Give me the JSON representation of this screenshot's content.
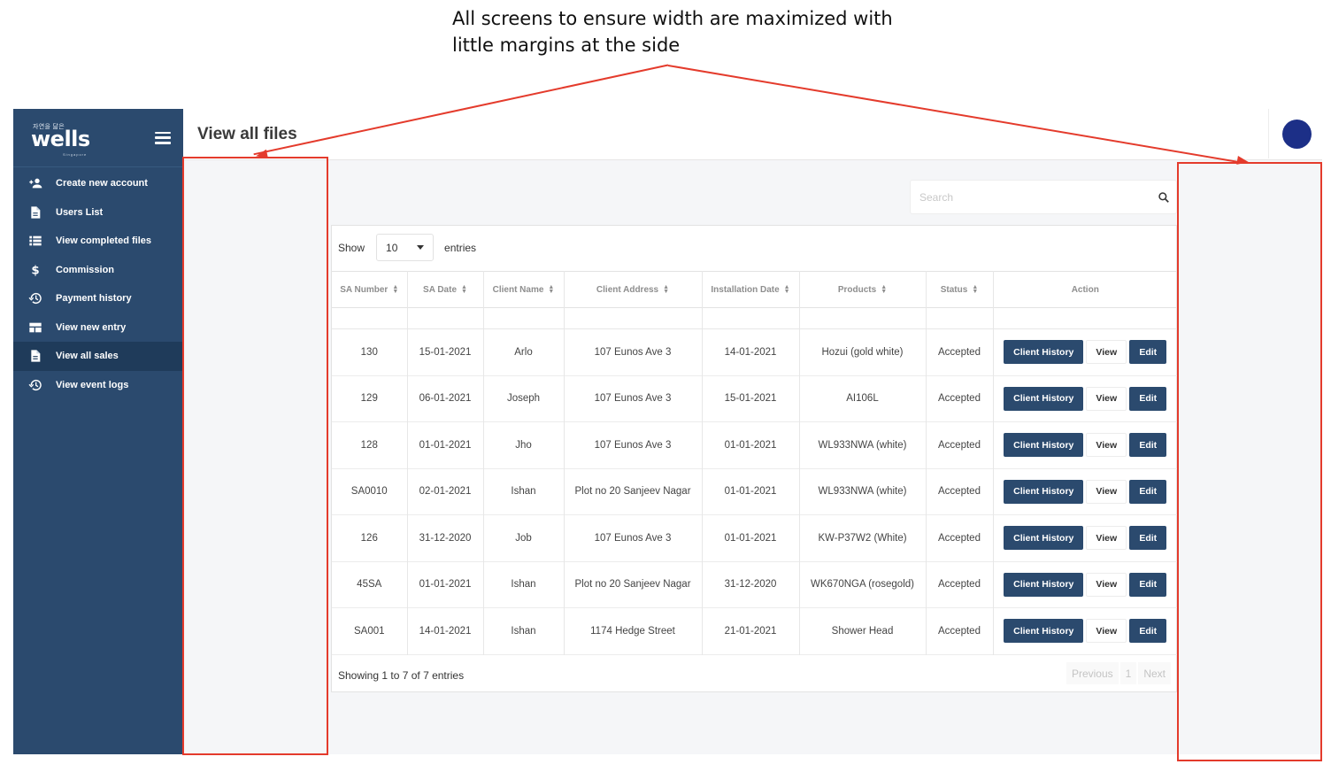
{
  "annotation": {
    "line1": "All screens to ensure width are maximized with",
    "line2": "little margins at the side"
  },
  "sidebar": {
    "logo_tag": "자연을 닮은",
    "logo_text": "wells",
    "logo_sub": "Singapore",
    "items": [
      {
        "label": "Create new account",
        "icon": "add-user-icon"
      },
      {
        "label": "Users List",
        "icon": "document-icon"
      },
      {
        "label": "View completed files",
        "icon": "list-icon"
      },
      {
        "label": "Commission",
        "icon": "dollar-icon"
      },
      {
        "label": "Payment history",
        "icon": "history-icon"
      },
      {
        "label": "View new entry",
        "icon": "table-icon"
      },
      {
        "label": "View all sales",
        "icon": "document-icon"
      },
      {
        "label": "View event logs",
        "icon": "history-icon"
      }
    ],
    "active_item": "View all sales"
  },
  "header": {
    "title": "View all files"
  },
  "search": {
    "placeholder": "Search",
    "icon": "search-icon"
  },
  "table_controls": {
    "show_label": "Show",
    "page_length": "10",
    "entries_label": "entries"
  },
  "table": {
    "columns": [
      "SA Number",
      "SA Date",
      "Client Name",
      "Client Address",
      "Installation Date",
      "Products",
      "Status",
      "Action"
    ],
    "rows": [
      {
        "sa_number": "130",
        "sa_date": "15-01-2021",
        "client_name": "Arlo",
        "client_address": "107 Eunos Ave 3",
        "installation_date": "14-01-2021",
        "products": "Hozui (gold white)",
        "status": "Accepted"
      },
      {
        "sa_number": "129",
        "sa_date": "06-01-2021",
        "client_name": "Joseph",
        "client_address": "107 Eunos Ave 3",
        "installation_date": "15-01-2021",
        "products": "AI106L",
        "status": "Accepted"
      },
      {
        "sa_number": "128",
        "sa_date": "01-01-2021",
        "client_name": "Jho",
        "client_address": "107 Eunos Ave 3",
        "installation_date": "01-01-2021",
        "products": "WL933NWA (white)",
        "status": "Accepted"
      },
      {
        "sa_number": "SA0010",
        "sa_date": "02-01-2021",
        "client_name": "Ishan",
        "client_address": "Plot no 20 Sanjeev Nagar",
        "installation_date": "01-01-2021",
        "products": "WL933NWA (white)",
        "status": "Accepted"
      },
      {
        "sa_number": "126",
        "sa_date": "31-12-2020",
        "client_name": "Job",
        "client_address": "107 Eunos Ave 3",
        "installation_date": "01-01-2021",
        "products": "KW-P37W2 (White)",
        "status": "Accepted"
      },
      {
        "sa_number": "45SA",
        "sa_date": "01-01-2021",
        "client_name": "Ishan",
        "client_address": "Plot no 20 Sanjeev Nagar",
        "installation_date": "31-12-2020",
        "products": "WK670NGA (rosegold)",
        "status": "Accepted"
      },
      {
        "sa_number": "SA001",
        "sa_date": "14-01-2021",
        "client_name": "Ishan",
        "client_address": "1174 Hedge Street",
        "installation_date": "21-01-2021",
        "products": "Shower Head",
        "status": "Accepted"
      }
    ],
    "action_labels": {
      "history": "Client History",
      "view": "View",
      "edit": "Edit"
    }
  },
  "footer": {
    "info": "Showing 1 to 7 of 7 entries",
    "previous": "Previous",
    "page": "1",
    "next": "Next"
  },
  "colors": {
    "sidebar_bg": "#2b4a6e",
    "sidebar_active": "#1f3b5a",
    "button_dark": "#2b4a6e",
    "avatar": "#1c2f87",
    "annotation_red": "#e43b2c",
    "content_bg": "#f5f6f8"
  }
}
